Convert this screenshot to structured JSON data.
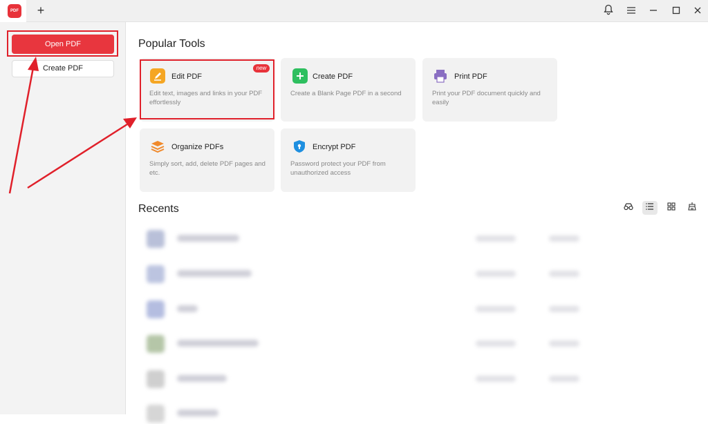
{
  "titlebar": {
    "app_logo_text": "PDF",
    "new_tab_glyph": "+",
    "icons": [
      "bell-icon",
      "menu-icon",
      "minimize-icon",
      "maximize-icon",
      "close-icon"
    ]
  },
  "sidebar": {
    "open_label": "Open PDF",
    "create_label": "Create PDF"
  },
  "popular": {
    "title": "Popular Tools",
    "tools": [
      {
        "title": "Edit PDF",
        "desc": "Edit text, images and links in your PDF effortlessly",
        "badge": "new",
        "icon": "edit-icon",
        "color": "#f5a623"
      },
      {
        "title": "Create PDF",
        "desc": "Create a Blank Page PDF in a second",
        "icon": "create-plus-icon",
        "color": "#2ebf5f"
      },
      {
        "title": "Print PDF",
        "desc": "Print your PDF document quickly and easily",
        "icon": "printer-icon",
        "color": "#8a6fc2"
      },
      {
        "title": "Organize PDFs",
        "desc": "Simply sort, add, delete PDF pages and etc.",
        "icon": "layers-icon",
        "color": "#f08a2c"
      },
      {
        "title": "Encrypt PDF",
        "desc": "Password protect your PDF from unauthorized access",
        "icon": "shield-lock-icon",
        "color": "#1e8fe0"
      }
    ]
  },
  "recents": {
    "title": "Recents",
    "view_icons": [
      "glasses-icon",
      "list-view-icon",
      "grid-view-icon",
      "cleanup-icon"
    ],
    "colors": {
      "accent": "#e8363e",
      "highlight": "#e0202a"
    }
  }
}
